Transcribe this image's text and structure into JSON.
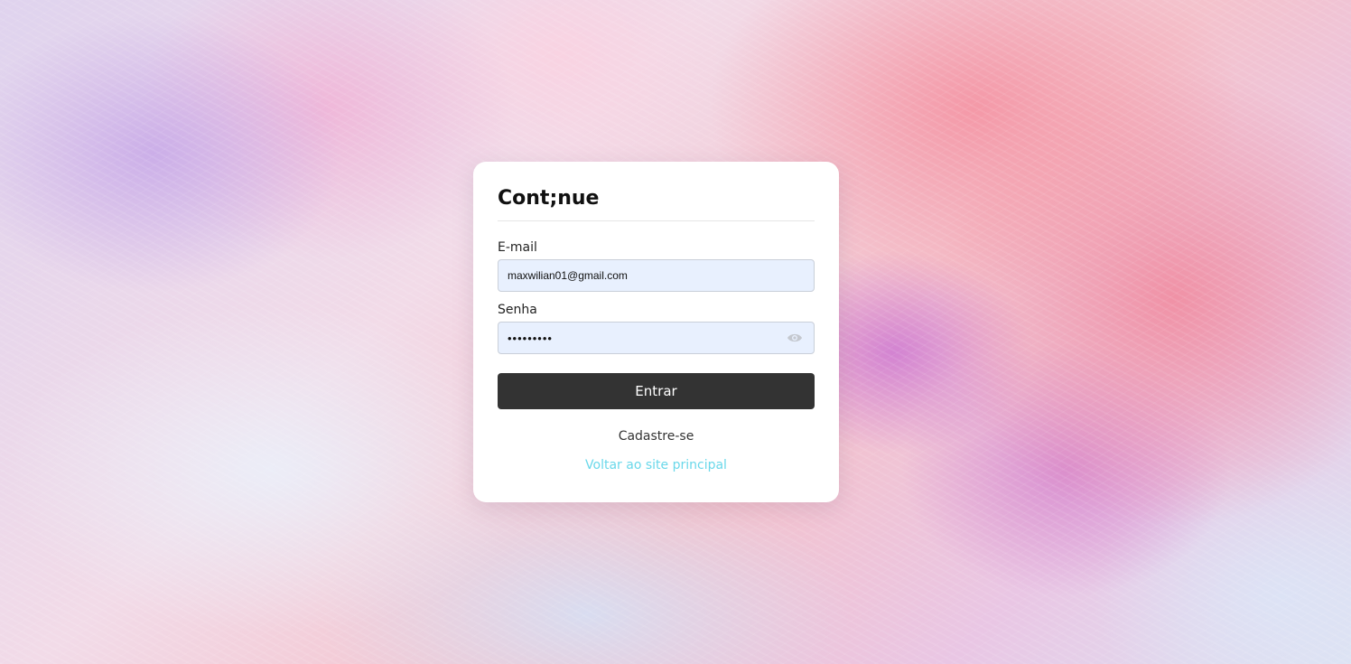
{
  "login": {
    "brand": "Cont;nue",
    "email_label": "E-mail",
    "email_value": "maxwilian01@gmail.com",
    "password_label": "Senha",
    "password_value": "•••••••••",
    "submit_label": "Entrar",
    "register_link": "Cadastre-se",
    "back_link": "Voltar ao site principal"
  },
  "icons": {
    "password_toggle": "eye-icon"
  },
  "colors": {
    "card_background": "#ffffff",
    "input_background": "#e8f0fe",
    "button_background": "#333333",
    "button_text": "#ffffff",
    "back_link": "#6ad8ea"
  }
}
